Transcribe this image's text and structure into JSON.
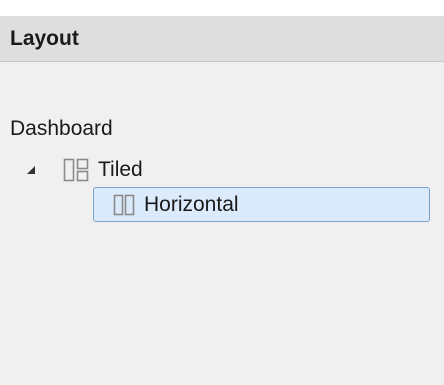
{
  "panel": {
    "title": "Layout"
  },
  "tree": {
    "root_label": "Dashboard",
    "items": [
      {
        "label": "Tiled",
        "icon": "tiled-layout-icon",
        "expanded": true
      },
      {
        "label": "Horizontal",
        "icon": "horizontal-layout-icon",
        "selected": true
      }
    ]
  },
  "colors": {
    "panel_background": "#f0f0f0",
    "header_background": "#dedede",
    "selection_background": "#dcebfc",
    "selection_border": "#7da2ce"
  }
}
